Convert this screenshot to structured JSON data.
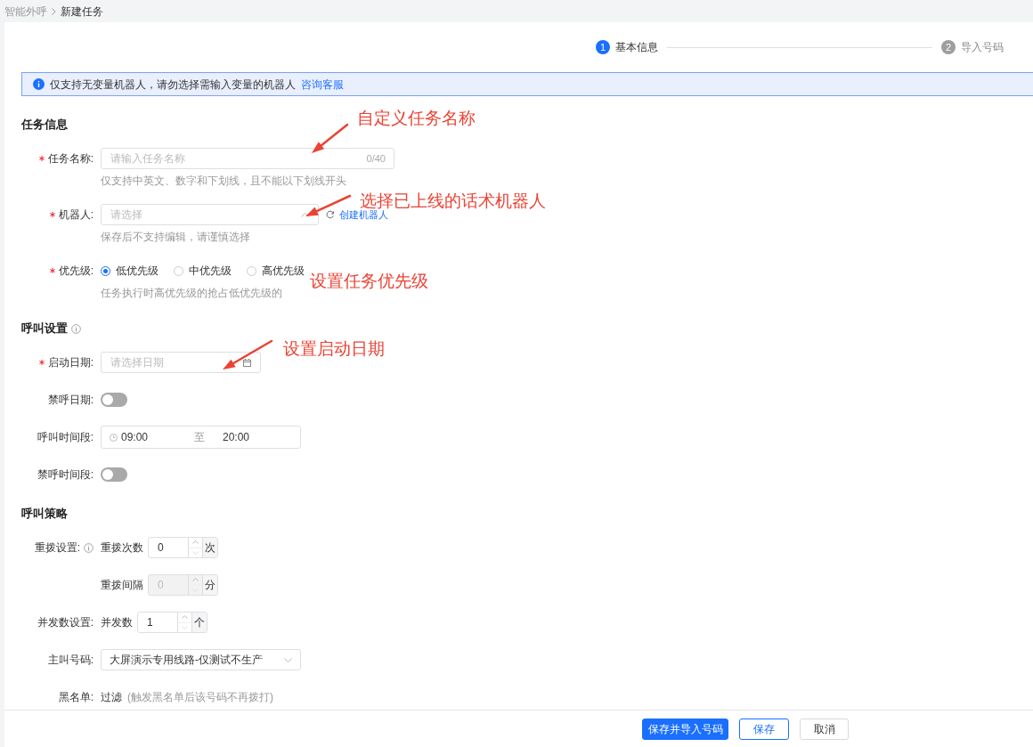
{
  "breadcrumb": [
    {
      "label": "智能外呼"
    },
    {
      "label": "新建任务"
    }
  ],
  "steps": [
    {
      "number": "1",
      "label": "基本信息",
      "selected": true
    },
    {
      "number": "2",
      "label": "导入号码",
      "selected": false
    }
  ],
  "notice": {
    "text": "仅支持无变量机器人，请勿选择需输入变量的机器人",
    "link": "咨询客服"
  },
  "sections": [
    {
      "title": "任务信息",
      "fields": [
        {
          "kind": "text_input",
          "label": "任务名称:",
          "required": true,
          "placeholder": "请输入任务名称",
          "counter": "0/40",
          "hint": "仅支持中英文、数字和下划线，且不能以下划线开头"
        },
        {
          "kind": "select",
          "label": "机器人:",
          "required": true,
          "placeholder": "请选择",
          "link": "创建机器人",
          "hint": "保存后不支持编辑，请谨慎选择"
        },
        {
          "kind": "radio",
          "label": "优先级:",
          "required": true,
          "options": [
            {
              "label": "低优先级",
              "selected": true
            },
            {
              "label": "中优先级",
              "selected": false
            },
            {
              "label": "高优先级",
              "selected": false
            }
          ],
          "hint": "任务执行时高优先级的抢占低优先级的"
        }
      ]
    },
    {
      "title": "呼叫设置",
      "info_icon": true,
      "fields": [
        {
          "kind": "date",
          "label": "启动日期:",
          "required": true,
          "placeholder": "请选择日期"
        },
        {
          "kind": "switch",
          "label": "禁呼日期:",
          "on": false
        },
        {
          "kind": "time_range",
          "label": "呼叫时间段:",
          "start": "09:00",
          "separator": "至",
          "end": "20:00"
        },
        {
          "kind": "switch",
          "label": "禁呼时间段:",
          "on": false
        }
      ]
    },
    {
      "title": "呼叫策略",
      "fields": [
        {
          "kind": "number",
          "label": "重拨设置:",
          "info_icon": true,
          "prefix": "重拨次数",
          "value": "0",
          "unit": "次",
          "disabled": false
        },
        {
          "kind": "number",
          "prefix": "重拨间隔",
          "value": "0",
          "unit": "分",
          "disabled": true
        },
        {
          "kind": "number",
          "label": "并发数设置:",
          "prefix": "并发数",
          "value": "1",
          "unit": "个",
          "disabled": false
        },
        {
          "kind": "select_value",
          "label": "主叫号码:",
          "value": "大屏演示专用线路-仅测试不生产"
        },
        {
          "kind": "text",
          "label": "黑名单:",
          "value": "过滤",
          "note": "(触发黑名单后该号码不再拨打)"
        }
      ]
    }
  ],
  "annotations": [
    {
      "text": "自定义任务名称"
    },
    {
      "text": "选择已上线的话术机器人"
    },
    {
      "text": "设置任务优先级"
    },
    {
      "text": "设置启动日期"
    }
  ],
  "footer_buttons": [
    {
      "label": "保存并导入号码",
      "kind": "primary"
    },
    {
      "label": "保存",
      "kind": "outline"
    },
    {
      "label": "取消",
      "kind": "default"
    }
  ]
}
